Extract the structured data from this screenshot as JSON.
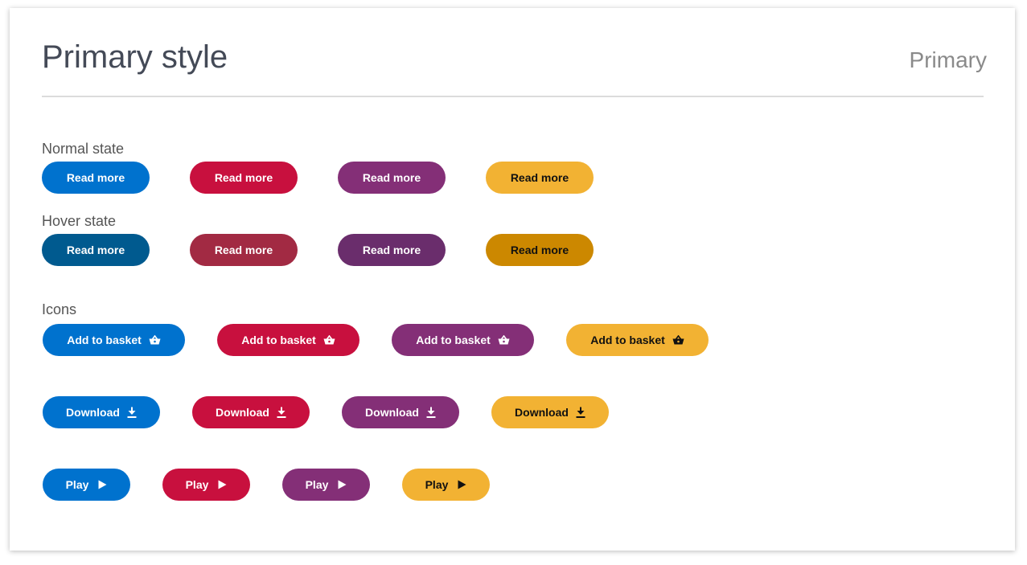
{
  "header": {
    "title": "Primary style",
    "tag": "Primary"
  },
  "colors": {
    "blue": "#0072ce",
    "red": "#c8103e",
    "purple": "#842f77",
    "yellow": "#f2b233",
    "blue_hover": "#005a8f",
    "red_hover": "#a22a43",
    "purple_hover": "#6a2d6c",
    "yellow_hover": "#cc8800",
    "text_light": "#ffffff",
    "text_dark": "#111111"
  },
  "sections": {
    "normal": {
      "label": "Normal state",
      "button_label": "Read more"
    },
    "hover": {
      "label": "Hover state",
      "button_label": "Read more"
    },
    "icons": {
      "label": "Icons",
      "basket_label": "Add to basket",
      "basket_icon": "basket-icon",
      "download_label": "Download",
      "download_icon": "download-icon",
      "play_label": "Play",
      "play_icon": "play-icon"
    }
  }
}
